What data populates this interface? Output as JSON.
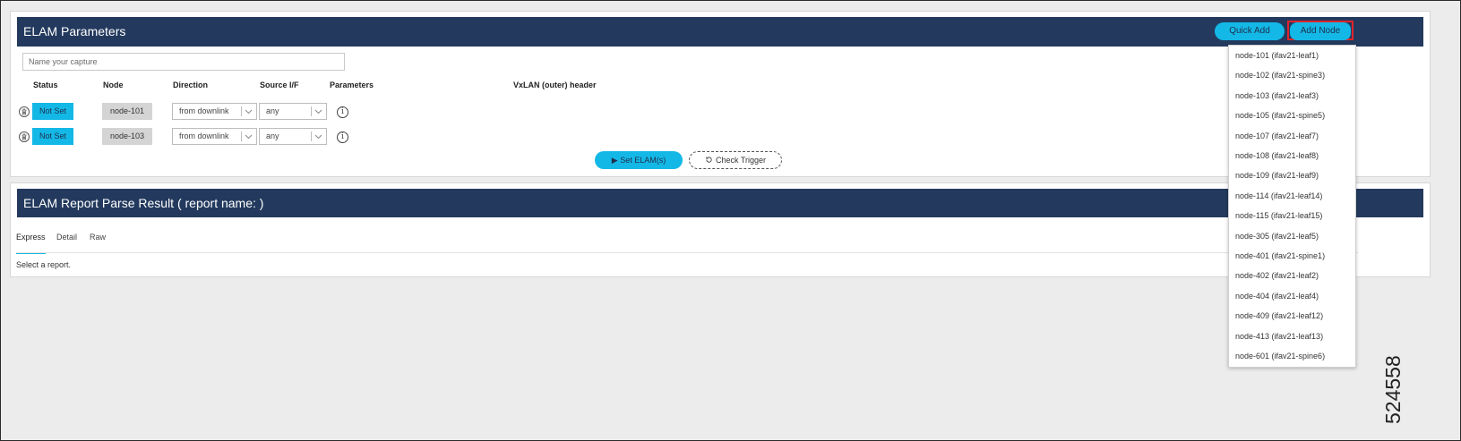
{
  "elam_panel": {
    "title": "ELAM Parameters",
    "quick_add_label": "Quick Add",
    "add_node_label": "Add Node",
    "capture_placeholder": "Name your capture",
    "columns": {
      "status": "Status",
      "node": "Node",
      "direction": "Direction",
      "source_if": "Source I/F",
      "parameters": "Parameters",
      "vxlan": "VxLAN (outer) header"
    },
    "rows": [
      {
        "status": "Not Set",
        "node": "node-101",
        "direction": "from downlink",
        "source_if": "any"
      },
      {
        "status": "Not Set",
        "node": "node-103",
        "direction": "from downlink",
        "source_if": "any"
      }
    ],
    "set_elam_label": "▶ Set ELAM(s)",
    "check_trigger_label": "Check Trigger"
  },
  "report_panel": {
    "title": "ELAM Report Parse Result ( report name: )",
    "tabs": [
      {
        "label": "Express"
      },
      {
        "label": "Detail"
      },
      {
        "label": "Raw"
      }
    ],
    "empty_message": "Select a report."
  },
  "node_dropdown": {
    "items": [
      "node-101 (ifav21-leaf1)",
      "node-102 (ifav21-spine3)",
      "node-103 (ifav21-leaf3)",
      "node-105 (ifav21-spine5)",
      "node-107 (ifav21-leaf7)",
      "node-108 (ifav21-leaf8)",
      "node-109 (ifav21-leaf9)",
      "node-114 (ifav21-leaf14)",
      "node-115 (ifav21-leaf15)",
      "node-305 (ifav21-leaf5)",
      "node-401 (ifav21-spine1)",
      "node-402 (ifav21-leaf2)",
      "node-404 (ifav21-leaf4)",
      "node-409 (ifav21-leaf12)",
      "node-413 (ifav21-leaf13)",
      "node-601 (ifav21-spine6)"
    ]
  },
  "figure_id": "524558",
  "colors": {
    "header_bg": "#233a5e",
    "accent": "#14b8e6",
    "highlight_border": "#e0242c"
  },
  "icons": [
    "trash-icon",
    "info-icon",
    "chevron-down-icon",
    "play-icon",
    "refresh-icon"
  ]
}
